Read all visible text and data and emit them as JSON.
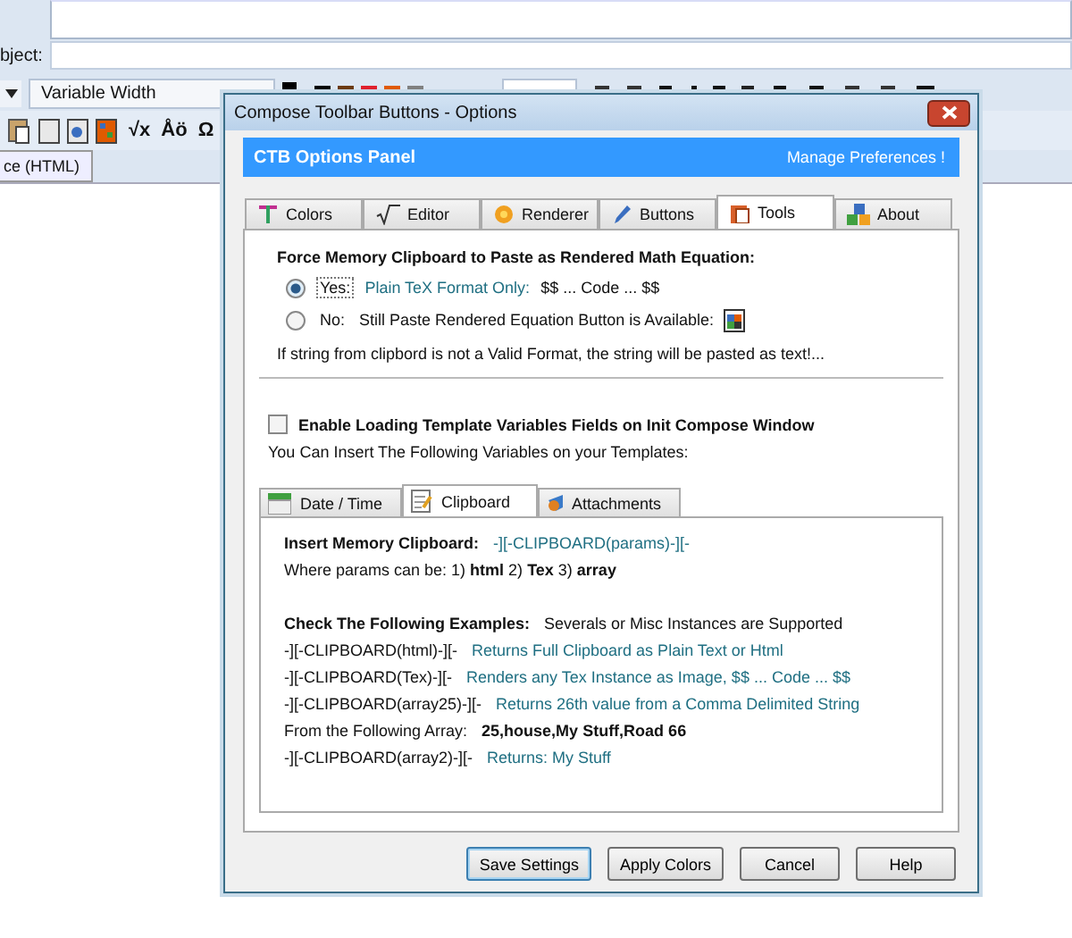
{
  "compose": {
    "subject_label": "bject:",
    "font_select": "Variable Width",
    "swatches": [
      {
        "color": "#000000"
      },
      {
        "color": "#6b3a10"
      },
      {
        "color": "#e0202c"
      },
      {
        "color": "#e05a00"
      },
      {
        "color": "#808080"
      }
    ],
    "insert_buttons": [
      "√x",
      "Åö",
      "Ω"
    ],
    "mode_tab": "ce (HTML)"
  },
  "dialog": {
    "title": "Compose Toolbar Buttons - Options",
    "banner_title": "CTB Options Panel",
    "banner_link": "Manage Preferences !",
    "tabs": [
      {
        "label": "Colors",
        "selected": false
      },
      {
        "label": "Editor",
        "selected": false
      },
      {
        "label": "Renderer",
        "selected": false
      },
      {
        "label": "Buttons",
        "selected": false
      },
      {
        "label": "Tools",
        "selected": true
      },
      {
        "label": "About",
        "selected": false
      }
    ],
    "force_heading": "Force Memory Clipboard to Paste as Rendered Math Equation:",
    "options": [
      {
        "label": "Yes:",
        "note": "Plain TeX Format Only:",
        "value": "$$ ... Code ... $$",
        "selected": true
      },
      {
        "label": "No:",
        "note": "Still Paste Rendered Equation Button is Available:",
        "selected": false
      }
    ],
    "notice": "If string from clipbord is not a Valid Format, the string will be pasted as text!...",
    "template_checkbox": {
      "label": "Enable Loading Template Variables Fields on Init Compose Window",
      "checked": false
    },
    "variables_hint": "You Can Insert The Following Variables on your Templates:",
    "sub_tabs": [
      {
        "label": "Date / Time",
        "selected": false
      },
      {
        "label": "Clipboard",
        "selected": true
      },
      {
        "label": "Attachments",
        "selected": false
      }
    ],
    "clipboard_intro": [
      {
        "parts": [
          {
            "kind": "label",
            "text": "Insert Memory Clipboard:"
          },
          {
            "kind": "code",
            "text": "-][-CLIPBOARD(params)-][-"
          }
        ]
      },
      {
        "parts": [
          {
            "kind": "body",
            "text": "Where params can be:  1)  **html**  2)  **Tex**  3)  **array**"
          }
        ]
      }
    ],
    "clipboard_examples": [
      {
        "parts": [
          {
            "kind": "label",
            "text": "Check The Following Examples:"
          },
          {
            "kind": "body",
            "text": "Severals or Misc Instances are Supported"
          }
        ]
      },
      {
        "parts": [
          {
            "kind": "body",
            "text": "-][-CLIPBOARD(html)-][-"
          },
          {
            "kind": "code",
            "text": "Returns Full Clipboard as Plain Text or Html"
          }
        ]
      },
      {
        "parts": [
          {
            "kind": "body",
            "text": "-][-CLIPBOARD(Tex)-][-"
          },
          {
            "kind": "code",
            "text": "Renders any Tex Instance as Image, $$ ... Code ... $$"
          }
        ]
      },
      {
        "parts": [
          {
            "kind": "body",
            "text": "-][-CLIPBOARD(array25)-][-"
          },
          {
            "kind": "code",
            "text": "Returns 26th value from a Comma Delimited String"
          }
        ]
      },
      {
        "parts": [
          {
            "kind": "body",
            "text": "From the Following Array:"
          },
          {
            "kind": "label",
            "text": "25,house,My Stuff,Road 66"
          }
        ]
      },
      {
        "parts": [
          {
            "kind": "body",
            "text": "-][-CLIPBOARD(array2)-][-"
          },
          {
            "kind": "code",
            "text": "Returns: My Stuff"
          }
        ]
      }
    ],
    "buttons": [
      {
        "label": "Save Settings",
        "default": true
      },
      {
        "label": "Apply Colors",
        "default": false
      },
      {
        "label": "Cancel",
        "default": false
      },
      {
        "label": "Help",
        "default": false
      }
    ]
  }
}
